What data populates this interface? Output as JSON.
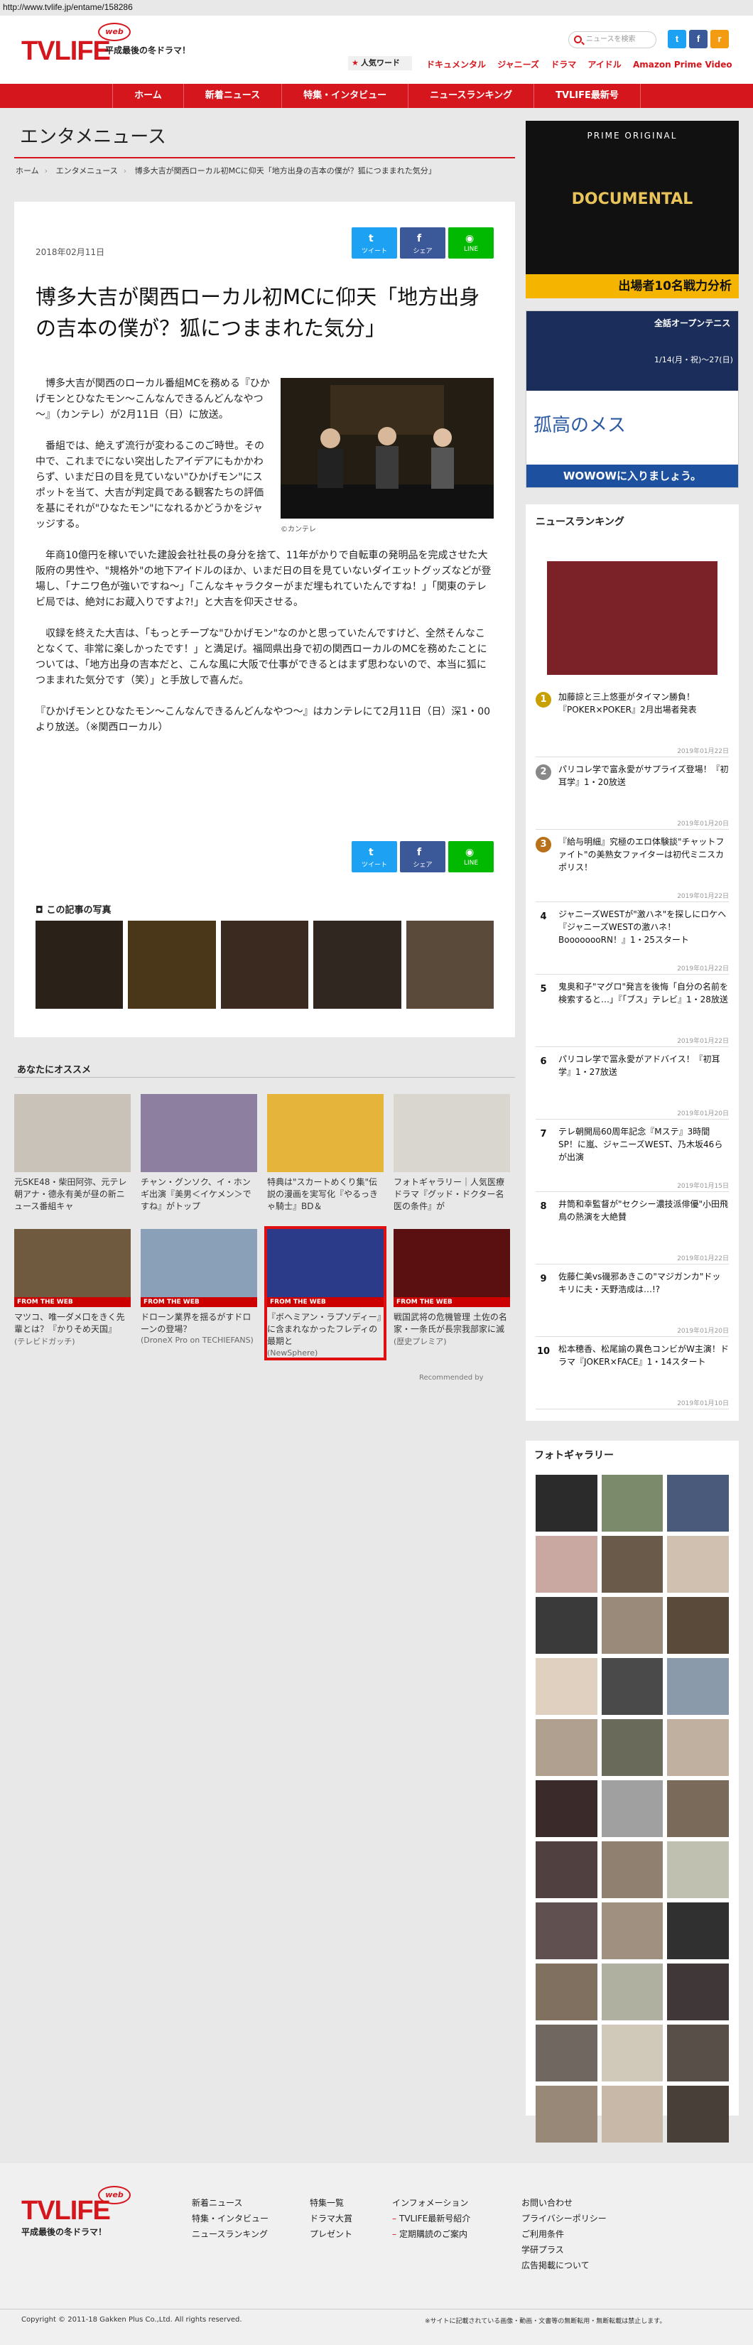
{
  "url": "http://www.tvlife.jp/entame/158286",
  "header": {
    "logo": "TVLIFE",
    "logo_badge": "web",
    "tagline": "平成最後の冬ドラマ！",
    "search_placeholder": "ニュースを検索",
    "social": {
      "twitter": "t",
      "facebook": "f",
      "rss": "r"
    },
    "hot_word": "人気ワード",
    "links": [
      "ドキュメンタル",
      "ジャニーズ",
      "ドラマ",
      "アイドル",
      "Amazon Prime Video"
    ]
  },
  "nav": [
    "ホーム",
    "新着ニュース",
    "特集・インタビュー",
    "ニュースランキング",
    "TVLIFE最新号"
  ],
  "page_heading": "エンタメニュース",
  "breadcrumb": [
    "ホーム",
    "エンタメニュース",
    "博多大吉が関西ローカル初MCに仰天「地方出身の吉本の僕が？狐につままれた気分」"
  ],
  "article": {
    "date": "2018年02月11日",
    "share": {
      "tweet": "ツイート",
      "share": "シェア",
      "line": "LINE"
    },
    "title": "博多大吉が関西ローカル初MCに仰天「地方出身の吉本の僕が？狐につままれた気分」",
    "paragraphs": [
      "博多大吉が関西のローカル番組MCを務める『ひかげモンとひなたモン～こんなんできるんどんなやつ～』（カンテレ）が2月11日（日）に放送。",
      "番組では、絶えず流行が変わるこのご時世。その中で、これまでにない突出したアイデアにもかかわらず、いまだ日の目を見ていない\"ひかげモン\"にスポットを当て、大吉が判定員である観客たちの評価を基にそれが\"ひなたモン\"になれるかどうかをジャッジする。",
      "年商10億円を稼いでいた建設会社社長の身分を捨て、11年がかりで自転車の発明品を完成させた大阪府の男性や、\"規格外\"の地下アイドルのほか、いまだ日の目を見ていないダイエットグッズなどが登場し、「ナニワ色が強いですね～」「こんなキャラクターがまだ埋もれていたんですね！」「関東のテレビ局では、絶対にお蔵入りですよ?!」と大吉を仰天させる。",
      "収録を終えた大吉は、「もっとチープな\"ひかげモン\"なのかと思っていたんですけど、全然そんなことなくて、非常に楽しかったです！」と満足げ。福岡県出身で初の関西ローカルのMCを務めたことについては、「地方出身の吉本だと、こんな風に大阪で仕事ができるとはまず思わないので、本当に狐につままれた気分です（笑）」と手放しで喜んだ。",
      "『ひかげモンとひなたモン～こんなんできるんどんなやつ～』はカンテレにて2月11日（日）深1・00より放送。（※関西ローカル）"
    ],
    "photo_credit": "©カンテレ",
    "photos_heading": "この記事の写真"
  },
  "recommend": {
    "heading": "あなたにオススメ",
    "from_web": "FROM THE WEB",
    "recommended_by": "Recommended by",
    "cards": [
      {
        "text": "元SKE48・柴田阿弥、元テレ朝アナ・德永有美が昼の新ニュース番組キャ",
        "source": ""
      },
      {
        "text": "チャン・グンソク、イ・ホンギ出演『美男＜イケメン＞ですね』がトップ",
        "source": ""
      },
      {
        "text": "特典は\"スカートめくり集\"伝説の漫画を実写化『やるっきゃ騎士』BD＆",
        "source": ""
      },
      {
        "text": "フォトギャラリー｜人気医療ドラマ『グッド・ドクター名医の条件』が",
        "source": ""
      },
      {
        "text": "マツコ、唯一ダメ口をきく先輩とは？『かりそめ天国』",
        "source": "(テレビドガッチ)"
      },
      {
        "text": "ドローン業界を揺るがすドローンの登場？",
        "source": "(DroneX Pro on TECHIEFANS)"
      },
      {
        "text": "『ボヘミアン・ラプソディー』に含まれなかったフレディの最期と",
        "source": "(NewSphere)"
      },
      {
        "text": "戦国武将の危機管理 土佐の名家・一条氏が長宗我部家に滅ぼされたワケ",
        "source": "(歴史プレミア)"
      }
    ]
  },
  "ranking": {
    "heading": "ニュースランキング",
    "items": [
      {
        "rank": "1",
        "text": "加藤諒と三上悠亜がタイマン勝負！『POKER×POKER』2月出場者発表",
        "date": "2019年01月22日"
      },
      {
        "rank": "2",
        "text": "パリコレ学で富永愛がサプライズ登場！『初耳学』1・20放送",
        "date": "2019年01月20日"
      },
      {
        "rank": "3",
        "text": "『給与明細』究極のエロ体験談\"チャットファイト\"の美熟女ファイターは初代ミニスカポリス！",
        "date": "2019年01月22日"
      },
      {
        "rank": "4",
        "text": "ジャニーズWESTが\"激ハネ\"を探しにロケへ『ジャニーズWESTの激ハネ！BoooooooRN！』1・25スタート",
        "date": "2019年01月22日"
      },
      {
        "rank": "5",
        "text": "鬼奥和子\"マグロ\"発言を後悔「自分の名前を検索すると…」『「ブス」テレビ』1・28放送",
        "date": "2019年01月22日"
      },
      {
        "rank": "6",
        "text": "パリコレ学で冨永愛がアドバイス！『初耳学』1・27放送",
        "date": "2019年01月20日"
      },
      {
        "rank": "7",
        "text": "テレ朝開局60周年記念『Mステ』3時間SP！に嵐、ジャニーズWEST、乃木坂46らが出演",
        "date": "2019年01月15日"
      },
      {
        "rank": "8",
        "text": "井筒和幸監督が\"セクシー濃技派俳優\"小田飛鳥の熱演を大絶賛",
        "date": "2019年01月22日"
      },
      {
        "rank": "9",
        "text": "佐藤仁美vs磯邪あきこの\"マジガンカ\"ドッキリに夫・天野浩成は…!?",
        "date": "2019年01月20日"
      },
      {
        "rank": "10",
        "text": "松本穂香、松尾諭の異色コンビがW主演！ドラマ『JOKER×FACE』1・14スタート",
        "date": "2019年01月10日"
      }
    ]
  },
  "photo_gallery": {
    "heading": "フォトギャラリー"
  },
  "ads": {
    "ad1_title": "PRIME ORIGINAL",
    "ad1_sub": "DOCUMENTAL",
    "ad1_caption": "出場者10名戦力分析",
    "ad2_head": "全話オープンテニス",
    "ad2_date": "1/14(月・祝)～27(日)",
    "ad2_drama": "孤高のメス",
    "ad2_footer": "WOWOWに入りましょう。"
  },
  "footer": {
    "logo": "TVLIFE",
    "badge": "web",
    "tagline": "平成最後の冬ドラマ！",
    "col1": [
      "新着ニュース",
      "特集・インタビュー",
      "ニュースランキング"
    ],
    "col2": [
      "特集一覧",
      "ドラマ大賞",
      "プレゼント"
    ],
    "col3": [
      "インフォメーション",
      "TVLIFE最新号紹介",
      "定期購読のご案内"
    ],
    "col4": [
      "お問い合わせ",
      "プライバシーポリシー",
      "ご利用条件",
      "学研プラス",
      "広告掲載について"
    ],
    "copyright": "Copyright © 2011-18 Gakken Plus Co.,Ltd. All rights reserved.",
    "note": "※サイトに記載されている画像・動画・文書等の無断転用・無断転載は禁止します。"
  },
  "colors": {
    "brand_red": "#d5161d",
    "twitter": "#1da1f2",
    "facebook": "#3b5998",
    "line": "#00b900"
  }
}
